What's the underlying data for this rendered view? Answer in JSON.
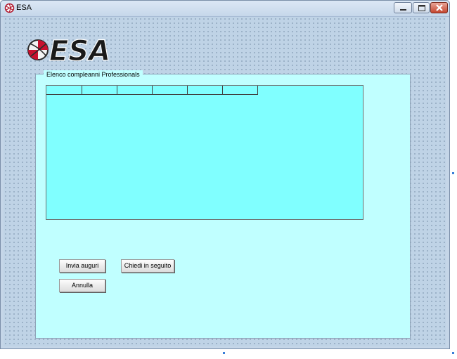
{
  "window": {
    "title": "ESA",
    "icon": "esa-app-icon",
    "controls": [
      "minimize-icon",
      "maximize-icon",
      "close-icon"
    ]
  },
  "logo": {
    "text": "ESA"
  },
  "group": {
    "title": "Elenco compleanni Professionals"
  },
  "grid": {
    "columns": [
      "",
      "",
      "",
      "",
      "",
      ""
    ],
    "rows": []
  },
  "buttons": {
    "send_wishes": "Invia auguri",
    "ask_later": "Chiedi in seguito",
    "cancel": "Annulla"
  },
  "colors": {
    "form_background": "#c0ffff",
    "grid_background": "#80ffff",
    "window_background": "#bfd3e6",
    "logo_red": "#c8102e"
  }
}
